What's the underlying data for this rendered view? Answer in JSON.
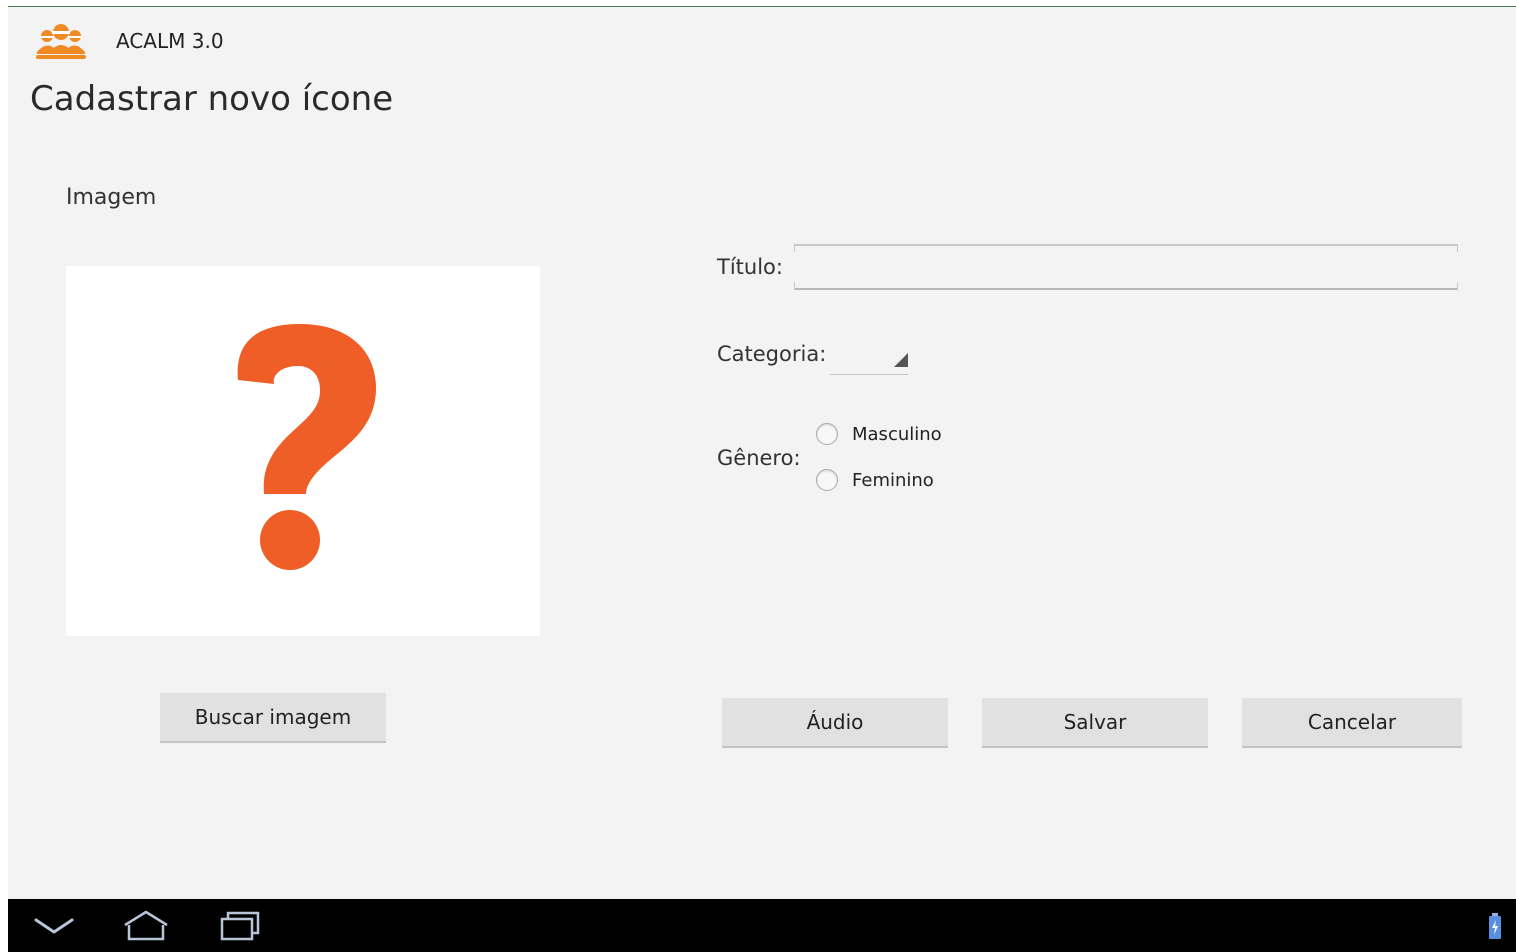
{
  "app": {
    "title": "ACALM 3.0",
    "logo_icon": "people-group-icon",
    "accent": "#f08a24"
  },
  "page": {
    "title": "Cadastrar novo ícone"
  },
  "image_section": {
    "label": "Imagem",
    "placeholder_icon": "question-mark-icon",
    "placeholder_color": "#ee5e26",
    "search_button": "Buscar imagem"
  },
  "form": {
    "titulo_label": "Título:",
    "titulo_value": "",
    "categoria_label": "Categoria:",
    "categoria_value": "",
    "genero_label": "Gênero:",
    "genero_options": [
      "Masculino",
      "Feminino"
    ]
  },
  "actions": {
    "audio": "Áudio",
    "save": "Salvar",
    "cancel": "Cancelar"
  },
  "system_nav": {
    "back_icon": "chevron-down-icon",
    "home_icon": "home-icon",
    "recent_icon": "recent-apps-icon",
    "battery_icon": "battery-charging-icon"
  }
}
